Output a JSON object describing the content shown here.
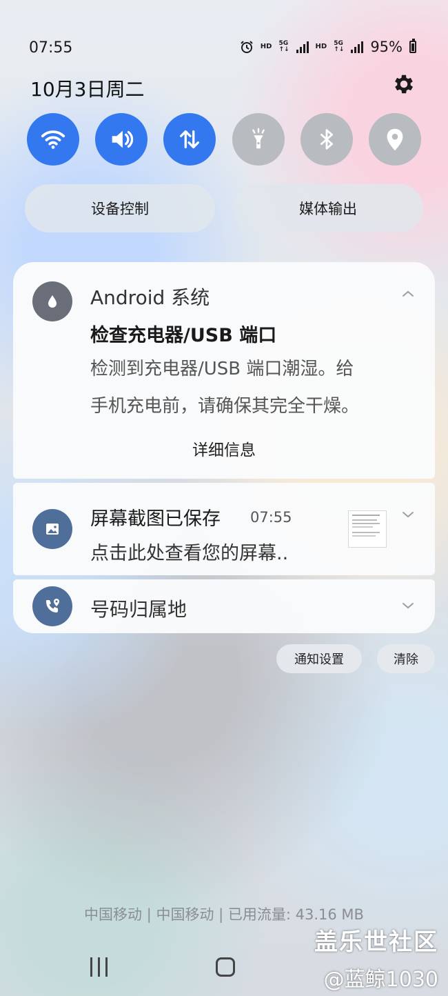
{
  "status_bar": {
    "time": "07:55",
    "hd1": "HD",
    "net1": [
      "5G",
      "↑↓"
    ],
    "hd2": "HD",
    "net2": [
      "5G",
      "↑↓"
    ],
    "battery_percent": "95%",
    "icons": [
      "alarm-icon",
      "signal-icon",
      "battery-icon"
    ]
  },
  "header": {
    "date": "10月3日周二",
    "settings_icon": "gear-icon"
  },
  "quick_toggles": [
    {
      "icon": "wifi-icon",
      "on": true
    },
    {
      "icon": "sound-icon",
      "on": true
    },
    {
      "icon": "mobile-data-icon",
      "on": true
    },
    {
      "icon": "flashlight-icon",
      "on": false
    },
    {
      "icon": "bluetooth-icon",
      "on": false
    },
    {
      "icon": "location-icon",
      "on": false
    }
  ],
  "controls": {
    "device_control": "设备控制",
    "media_output": "媒体输出"
  },
  "notifications": [
    {
      "app": "Android 系统",
      "title": "检查充电器/USB 端口",
      "body_line1": "检测到充电器/USB 端口潮湿。给",
      "body_line2": "手机充电前，请确保其完全干燥。",
      "action": "详细信息",
      "icon": "water-drop-icon"
    },
    {
      "title": "屏幕截图已保存",
      "time": "07:55",
      "body": "点击此处查看您的屏幕..",
      "icon": "image-icon"
    },
    {
      "title": "号码归属地",
      "icon": "phone-location-icon"
    }
  ],
  "actions": {
    "notification_settings": "通知设置",
    "clear": "清除"
  },
  "footer": {
    "carrier": "中国移动 | 中国移动 | 已用流量: 43.16 MB"
  },
  "watermark": {
    "line1": "盖乐世社区",
    "line2": "@蓝鲸1030"
  },
  "colors": {
    "accent": "#3478f0",
    "toggle_off": "#b8bbbf",
    "avatar": "#4f6e9a"
  }
}
